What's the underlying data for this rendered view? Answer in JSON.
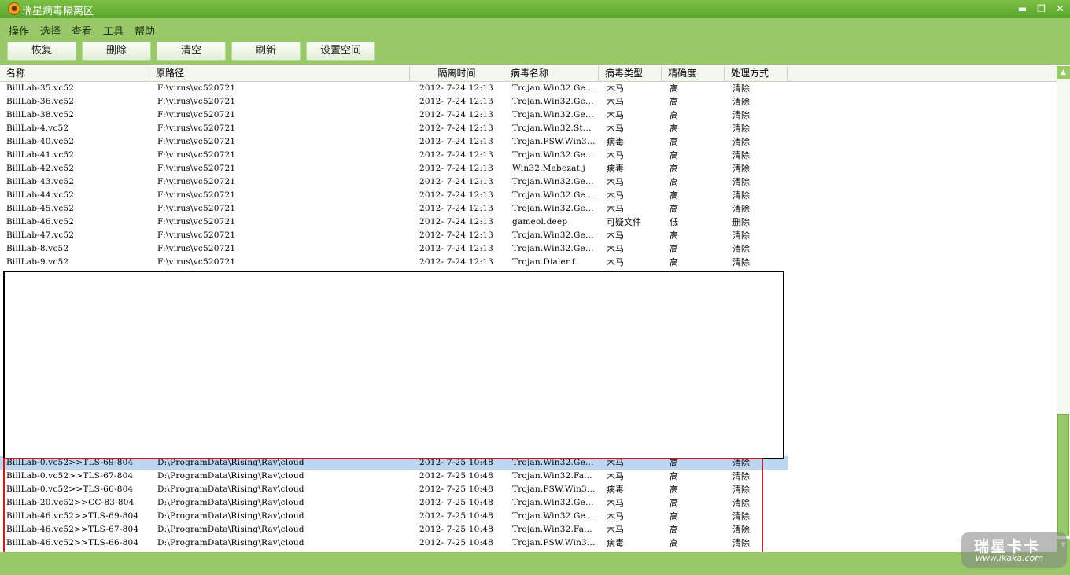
{
  "window": {
    "title": "瑞星病毒隔离区",
    "icon": "rising-lion-icon"
  },
  "menu": [
    "操作",
    "选择",
    "查看",
    "工具",
    "帮助"
  ],
  "toolbar": [
    "恢复",
    "删除",
    "清空",
    "刷新",
    "设置空间"
  ],
  "columns": [
    "名称",
    "原路径",
    "隔离时间",
    "病毒名称",
    "病毒类型",
    "精确度",
    "处理方式"
  ],
  "rows_top": [
    [
      "BillLab-35.vc52",
      "F:\\virus\\vc520721",
      "2012- 7-24 12:13",
      "Trojan.Win32.Ge...",
      "木马",
      "高",
      "清除"
    ],
    [
      "BillLab-36.vc52",
      "F:\\virus\\vc520721",
      "2012- 7-24 12:13",
      "Trojan.Win32.Ge...",
      "木马",
      "高",
      "清除"
    ],
    [
      "BillLab-38.vc52",
      "F:\\virus\\vc520721",
      "2012- 7-24 12:13",
      "Trojan.Win32.Ge...",
      "木马",
      "高",
      "清除"
    ],
    [
      "BillLab-4.vc52",
      "F:\\virus\\vc520721",
      "2012- 7-24 12:13",
      "Trojan.Win32.St...",
      "木马",
      "高",
      "清除"
    ],
    [
      "BillLab-40.vc52",
      "F:\\virus\\vc520721",
      "2012- 7-24 12:13",
      "Trojan.PSW.Win3...",
      "病毒",
      "高",
      "清除"
    ],
    [
      "BillLab-41.vc52",
      "F:\\virus\\vc520721",
      "2012- 7-24 12:13",
      "Trojan.Win32.Ge...",
      "木马",
      "高",
      "清除"
    ],
    [
      "BillLab-42.vc52",
      "F:\\virus\\vc520721",
      "2012- 7-24 12:13",
      "Win32.Mabezat.j",
      "病毒",
      "高",
      "清除"
    ],
    [
      "BillLab-43.vc52",
      "F:\\virus\\vc520721",
      "2012- 7-24 12:13",
      "Trojan.Win32.Ge...",
      "木马",
      "高",
      "清除"
    ],
    [
      "BillLab-44.vc52",
      "F:\\virus\\vc520721",
      "2012- 7-24 12:13",
      "Trojan.Win32.Ge...",
      "木马",
      "高",
      "清除"
    ],
    [
      "BillLab-45.vc52",
      "F:\\virus\\vc520721",
      "2012- 7-24 12:13",
      "Trojan.Win32.Ge...",
      "木马",
      "高",
      "清除"
    ],
    [
      "BillLab-46.vc52",
      "F:\\virus\\vc520721",
      "2012- 7-24 12:13",
      "gameol.deep",
      "可疑文件",
      "低",
      "删除"
    ],
    [
      "BillLab-47.vc52",
      "F:\\virus\\vc520721",
      "2012- 7-24 12:13",
      "Trojan.Win32.Ge...",
      "木马",
      "高",
      "清除"
    ],
    [
      "BillLab-8.vc52",
      "F:\\virus\\vc520721",
      "2012- 7-24 12:13",
      "Trojan.Win32.Ge...",
      "木马",
      "高",
      "清除"
    ],
    [
      "BillLab-9.vc52",
      "F:\\virus\\vc520721",
      "2012- 7-24 12:13",
      "Trojan.Dialer.f",
      "木马",
      "高",
      "清除"
    ]
  ],
  "rows_bottom": [
    [
      "BillLab-0.vc52>>TLS-69-804",
      "D:\\ProgramData\\Rising\\Rav\\cloud",
      "2012- 7-25 10:48",
      "Trojan.Win32.Ge...",
      "木马",
      "高",
      "清除"
    ],
    [
      "BillLab-0.vc52>>TLS-67-804",
      "D:\\ProgramData\\Rising\\Rav\\cloud",
      "2012- 7-25 10:48",
      "Trojan.Win32.Fa...",
      "木马",
      "高",
      "清除"
    ],
    [
      "BillLab-0.vc52>>TLS-66-804",
      "D:\\ProgramData\\Rising\\Rav\\cloud",
      "2012- 7-25 10:48",
      "Trojan.PSW.Win3...",
      "病毒",
      "高",
      "清除"
    ],
    [
      "BillLab-20.vc52>>CC-83-804",
      "D:\\ProgramData\\Rising\\Rav\\cloud",
      "2012- 7-25 10:48",
      "Trojan.Win32.Ge...",
      "木马",
      "高",
      "清除"
    ],
    [
      "BillLab-46.vc52>>TLS-69-804",
      "D:\\ProgramData\\Rising\\Rav\\cloud",
      "2012- 7-25 10:48",
      "Trojan.Win32.Ge...",
      "木马",
      "高",
      "清除"
    ],
    [
      "BillLab-46.vc52>>TLS-67-804",
      "D:\\ProgramData\\Rising\\Rav\\cloud",
      "2012- 7-25 10:48",
      "Trojan.Win32.Fa...",
      "木马",
      "高",
      "清除"
    ],
    [
      "BillLab-46.vc52>>TLS-66-804",
      "D:\\ProgramData\\Rising\\Rav\\cloud",
      "2012- 7-25 10:48",
      "Trojan.PSW.Win3...",
      "病毒",
      "高",
      "清除"
    ]
  ],
  "selected_bottom_row": 0,
  "watermark": {
    "title": "瑞星卡卡",
    "url": "www.ikaka.com"
  },
  "colors": {
    "accent": "#98c868",
    "titlebar": "#6ab236",
    "selection": "#bcd7ef",
    "highlight_border": "#d21a1a"
  }
}
